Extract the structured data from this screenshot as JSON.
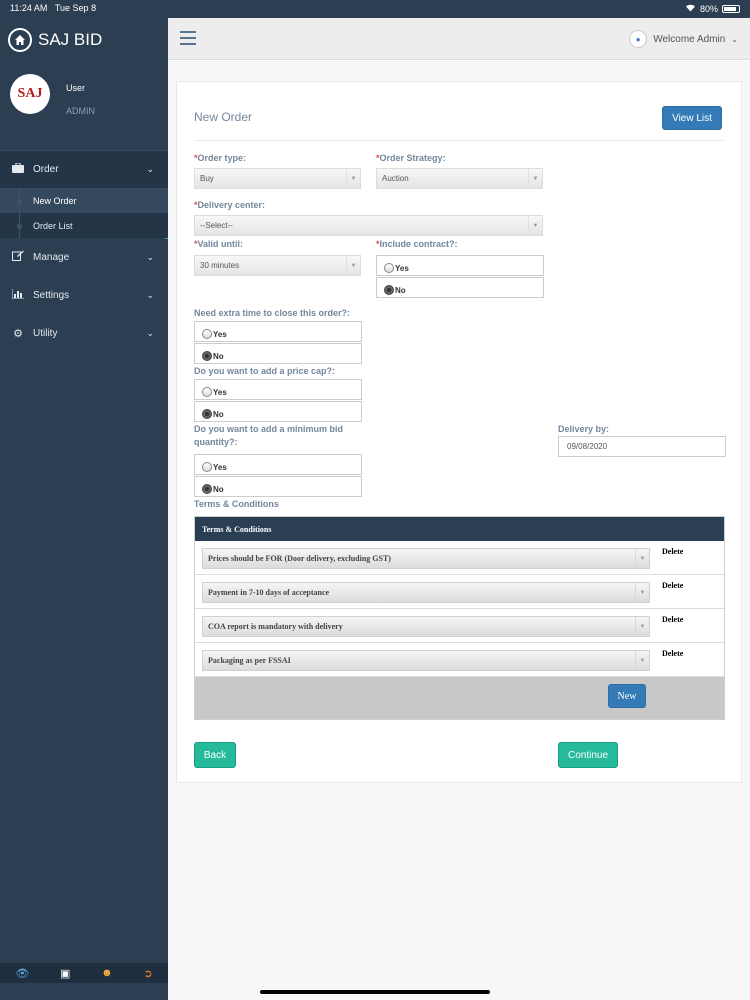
{
  "status": {
    "time": "11:24 AM",
    "date": "Tue Sep 8",
    "battery": "80%"
  },
  "sidebar": {
    "brand": "SAJ BID",
    "avatar_text": "SAJ",
    "user_name": "User",
    "user_role": "ADMIN",
    "nav": [
      {
        "label": "Order",
        "icon": "briefcase-icon",
        "expanded": true,
        "children": [
          {
            "label": "New Order",
            "active": true
          },
          {
            "label": "Order List",
            "active": false
          }
        ]
      },
      {
        "label": "Manage",
        "icon": "edit-icon"
      },
      {
        "label": "Settings",
        "icon": "bar-chart-icon"
      },
      {
        "label": "Utility",
        "icon": "gear-icon"
      }
    ]
  },
  "topnav": {
    "welcome": "Welcome Admin"
  },
  "form": {
    "title": "New Order",
    "view_list": "View List",
    "order_type": {
      "label": "Order type:",
      "value": "Buy"
    },
    "order_strategy": {
      "label": "Order Strategy:",
      "value": "Auction"
    },
    "delivery_center": {
      "label": "Delivery center:",
      "value": "--Select--"
    },
    "valid_until": {
      "label": "Valid until:",
      "value": "30 minutes"
    },
    "include_contract": {
      "label": "Include contract?:",
      "yes": "Yes",
      "no": "No",
      "selected": "No"
    },
    "extra_time": {
      "label": "Need extra time to close this order?:",
      "yes": "Yes",
      "no": "No",
      "selected": "No"
    },
    "price_cap": {
      "label": "Do you want to add a price cap?:",
      "yes": "Yes",
      "no": "No",
      "selected": "No"
    },
    "min_bid": {
      "label_line1": "Do you want to add a minimum bid",
      "label_line2": "quantity?:",
      "yes": "Yes",
      "no": "No",
      "selected": "No"
    },
    "delivery_by": {
      "label": "Delivery by:",
      "value": "09/08/2020"
    },
    "terms_label": "Terms & Conditions",
    "terms_table": {
      "header": "Terms & Conditions",
      "rows": [
        {
          "text": "Prices should be FOR (Door delivery, excluding GST)",
          "action": "Delete"
        },
        {
          "text": "Payment in 7-10 days of acceptance",
          "action": "Delete"
        },
        {
          "text": "COA report is mandatory with delivery",
          "action": "Delete"
        },
        {
          "text": "Packaging as per FSSAI",
          "action": "Delete"
        }
      ],
      "new_button": "New"
    },
    "back": "Back",
    "continue": "Continue"
  },
  "colors": {
    "sidebar": "#2b3e52",
    "accent": "#26b99a",
    "primary": "#337ab7"
  }
}
